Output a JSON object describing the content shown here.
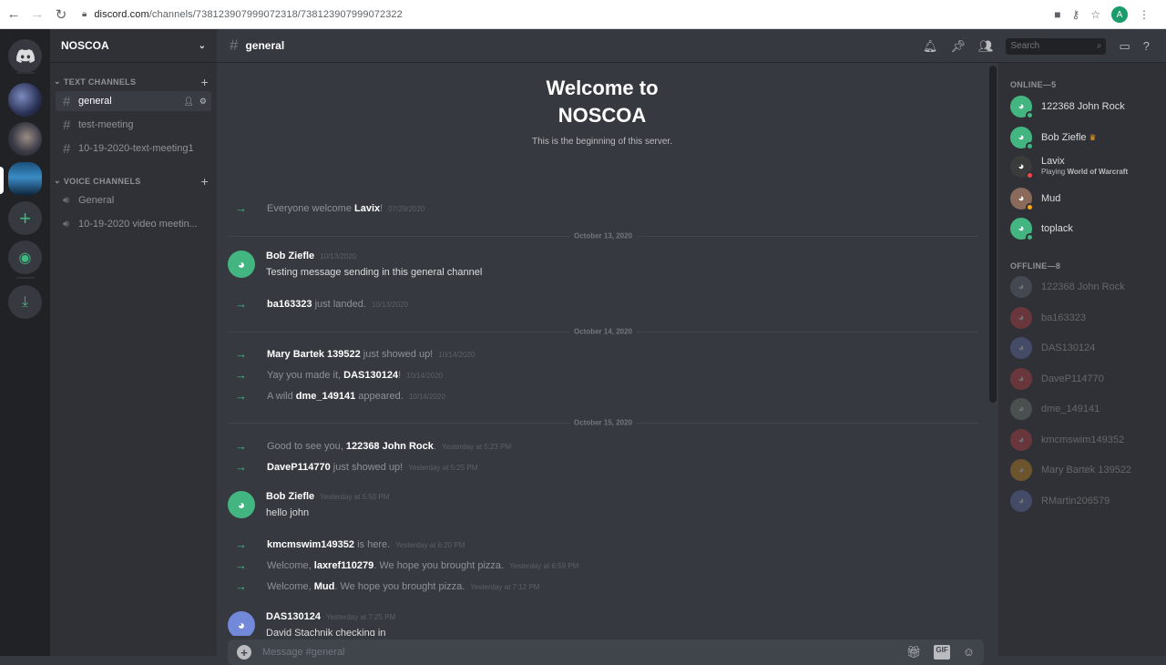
{
  "browser": {
    "url_host": "discord.com",
    "url_path": "/channels/738123907999072318/738123907999072322",
    "profile_initial": "A"
  },
  "server": {
    "name": "NOSCOA",
    "text_category": "TEXT CHANNELS",
    "voice_category": "VOICE CHANNELS",
    "text_channels": [
      "general",
      "test-meeting",
      "10-19-2020-text-meeting1"
    ],
    "voice_channels": [
      "General",
      "10-19-2020 video meetin..."
    ]
  },
  "channel": {
    "name": "general",
    "search_placeholder": "Search",
    "welcome_title": "Welcome to NOSCOA",
    "welcome_sub": "This is the beginning of this server.",
    "composer_placeholder": "Message #general",
    "gif_label": "GIF"
  },
  "messages": {
    "s1": {
      "pre": "Everyone welcome ",
      "name": "Lavix",
      "post": "!",
      "ts": "07/29/2020"
    },
    "d1": "October 13, 2020",
    "m1": {
      "author": "Bob Ziefle",
      "ts": "10/13/2020",
      "text": "Testing message sending in this general channel"
    },
    "s2": {
      "name": "ba163323",
      "post": " just landed.",
      "ts": "10/13/2020"
    },
    "d2": "October 14, 2020",
    "s3": {
      "name": "Mary Bartek 139522",
      "post": " just showed up!",
      "ts": "10/14/2020"
    },
    "s4": {
      "pre": "Yay you made it, ",
      "name": "DAS130124",
      "post": "!",
      "ts": "10/14/2020"
    },
    "s5": {
      "pre": "A wild ",
      "name": "dme_149141",
      "post": " appeared.",
      "ts": "10/14/2020"
    },
    "d3": "October 15, 2020",
    "s6": {
      "pre": "Good to see you, ",
      "name": "122368 John Rock",
      "post": ".",
      "ts": "Yesterday at 5:23 PM"
    },
    "s7": {
      "name": "DaveP114770",
      "post": " just showed up!",
      "ts": "Yesterday at 5:25 PM"
    },
    "m2": {
      "author": "Bob Ziefle",
      "ts": "Yesterday at 5:50 PM",
      "text": "hello john"
    },
    "s8": {
      "name": "kmcmswim149352",
      "post": " is here.",
      "ts": "Yesterday at 6:20 PM"
    },
    "s9": {
      "pre": "Welcome, ",
      "name": "laxref110279",
      "post": ". We hope you brought pizza.",
      "ts": "Yesterday at 6:59 PM"
    },
    "s10": {
      "pre": "Welcome, ",
      "name": "Mud",
      "post": ". We hope you brought pizza.",
      "ts": "Yesterday at 7:12 PM"
    },
    "m3": {
      "author": "DAS130124",
      "ts": "Yesterday at 7:25 PM",
      "text": "David Stachnik checking in"
    }
  },
  "members": {
    "online_header": "ONLINE—5",
    "offline_header": "OFFLINE—8",
    "online": [
      {
        "name": "122368 John Rock"
      },
      {
        "name": "Bob Ziefle"
      },
      {
        "name": "Lavix",
        "activity_pre": "Playing ",
        "activity": "World of Warcraft"
      },
      {
        "name": "Mud"
      },
      {
        "name": "toplack"
      }
    ],
    "offline": [
      "122368 John Rock",
      "ba163323",
      "DAS130124",
      "DaveP114770",
      "dme_149141",
      "kmcmswim149352",
      "Mary Bartek 139522",
      "RMartin206579"
    ]
  },
  "colors": {
    "green": "#43b581",
    "blurple": "#7289da",
    "red": "#f04747",
    "orange": "#faa61a"
  }
}
